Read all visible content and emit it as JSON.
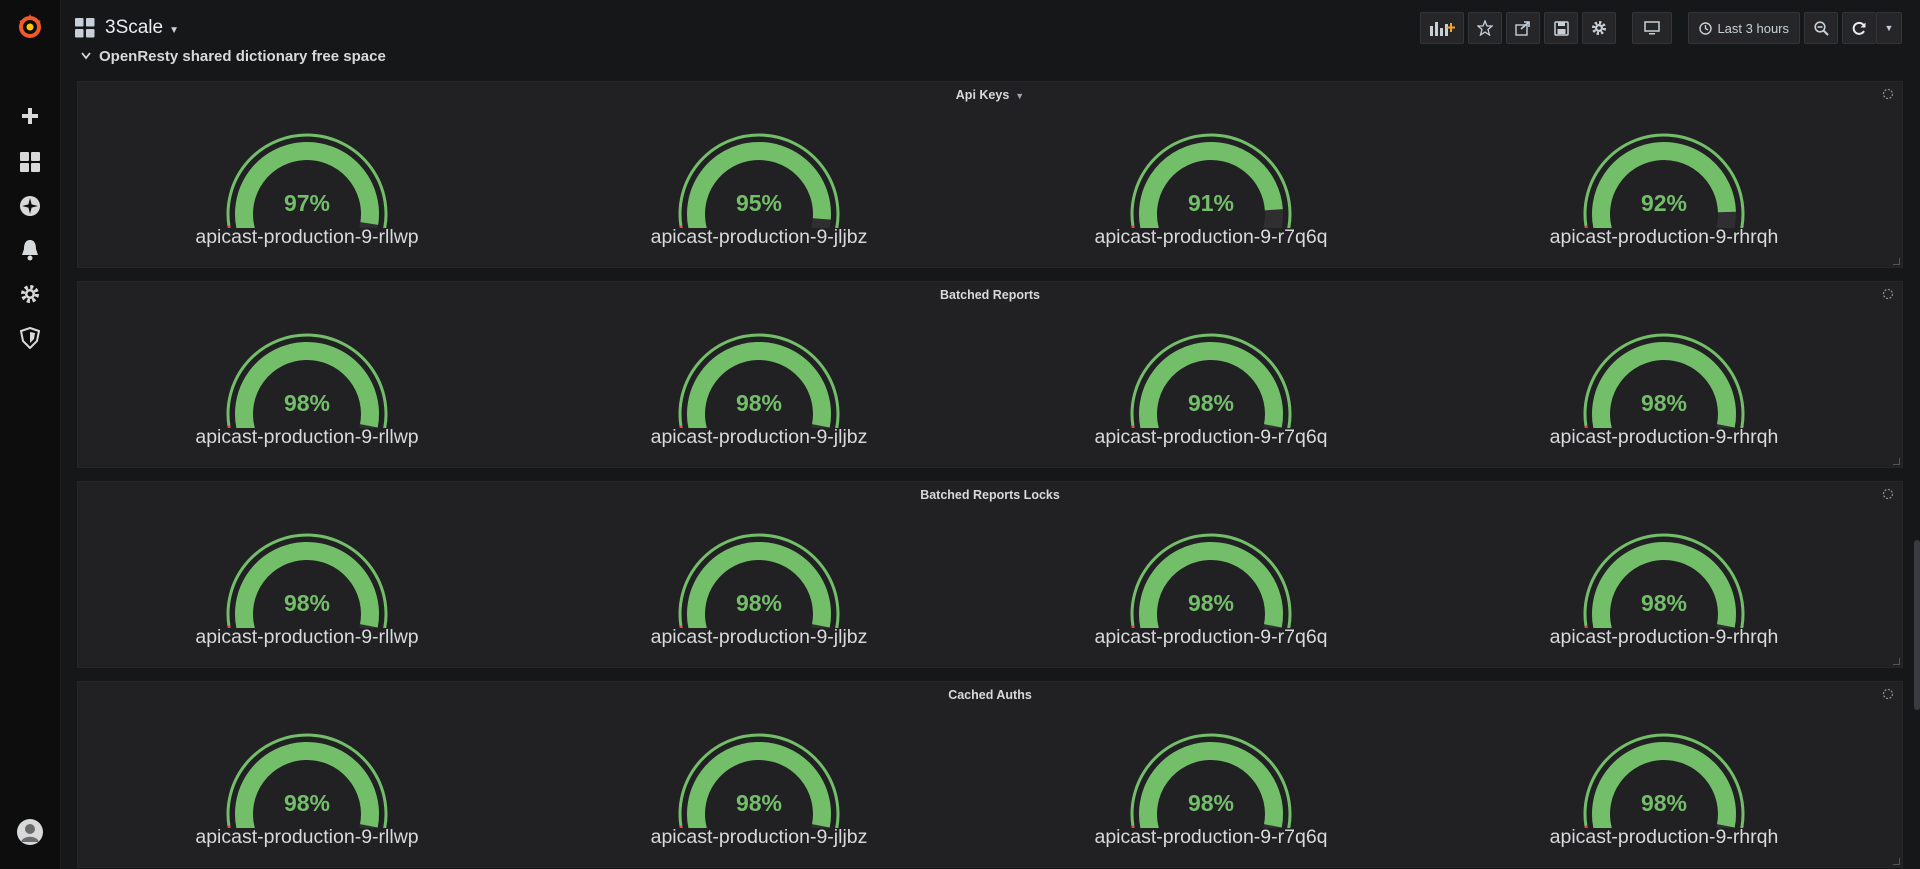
{
  "app": {
    "dashboard_title": "3Scale",
    "time_range_label": "Last 3 hours",
    "row_title": "OpenResty shared dictionary free space",
    "colors": {
      "gauge_fill": "#73bf69",
      "gauge_track": "#2f2f32",
      "threshold_red": "#e24d42",
      "threshold_green": "#73bf69"
    }
  },
  "sidebar": {
    "items": [
      {
        "icon": "grafana-logo-icon"
      },
      {
        "icon": "plus-icon"
      },
      {
        "icon": "dashboards-grid-icon"
      },
      {
        "icon": "explore-compass-icon"
      },
      {
        "icon": "alerting-bell-icon"
      },
      {
        "icon": "configuration-gear-icon"
      },
      {
        "icon": "server-admin-shield-icon"
      },
      {
        "icon": "user-avatar-icon"
      }
    ]
  },
  "toolbar": {
    "buttons": [
      {
        "icon": "add-panel-icon"
      },
      {
        "icon": "star-icon"
      },
      {
        "icon": "share-icon"
      },
      {
        "icon": "save-icon"
      },
      {
        "icon": "settings-gear-icon"
      },
      {
        "icon": "tv-mode-icon"
      },
      {
        "icon": "clock-icon"
      },
      {
        "icon": "zoom-out-icon"
      },
      {
        "icon": "refresh-icon"
      },
      {
        "icon": "refresh-interval-caret-icon"
      }
    ]
  },
  "panels": [
    {
      "title": "Api Keys",
      "has_menu_caret": true,
      "gauges": [
        {
          "value": 97,
          "label": "97%",
          "name": "apicast-production-9-rllwp"
        },
        {
          "value": 95,
          "label": "95%",
          "name": "apicast-production-9-jljbz"
        },
        {
          "value": 91,
          "label": "91%",
          "name": "apicast-production-9-r7q6q"
        },
        {
          "value": 92,
          "label": "92%",
          "name": "apicast-production-9-rhrqh"
        }
      ]
    },
    {
      "title": "Batched Reports",
      "has_menu_caret": false,
      "gauges": [
        {
          "value": 98,
          "label": "98%",
          "name": "apicast-production-9-rllwp"
        },
        {
          "value": 98,
          "label": "98%",
          "name": "apicast-production-9-jljbz"
        },
        {
          "value": 98,
          "label": "98%",
          "name": "apicast-production-9-r7q6q"
        },
        {
          "value": 98,
          "label": "98%",
          "name": "apicast-production-9-rhrqh"
        }
      ]
    },
    {
      "title": "Batched Reports Locks",
      "has_menu_caret": false,
      "gauges": [
        {
          "value": 98,
          "label": "98%",
          "name": "apicast-production-9-rllwp"
        },
        {
          "value": 98,
          "label": "98%",
          "name": "apicast-production-9-jljbz"
        },
        {
          "value": 98,
          "label": "98%",
          "name": "apicast-production-9-r7q6q"
        },
        {
          "value": 98,
          "label": "98%",
          "name": "apicast-production-9-rhrqh"
        }
      ]
    },
    {
      "title": "Cached Auths",
      "has_menu_caret": false,
      "gauges": [
        {
          "value": 98,
          "label": "98%",
          "name": "apicast-production-9-rllwp"
        },
        {
          "value": 98,
          "label": "98%",
          "name": "apicast-production-9-jljbz"
        },
        {
          "value": 98,
          "label": "98%",
          "name": "apicast-production-9-r7q6q"
        },
        {
          "value": 98,
          "label": "98%",
          "name": "apicast-production-9-rhrqh"
        }
      ]
    }
  ]
}
